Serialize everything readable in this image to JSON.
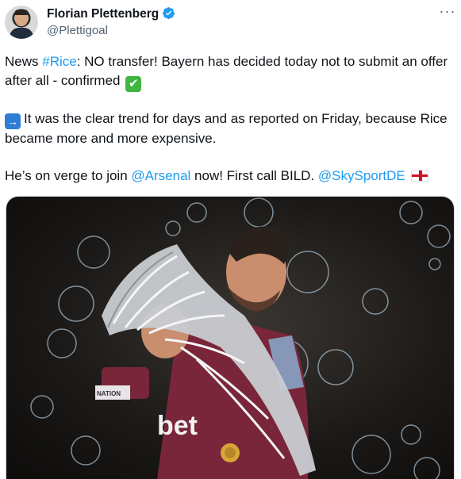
{
  "author": {
    "display_name": "Florian Plettenberg",
    "handle": "@Plettigoal",
    "verified": true,
    "avatar_icon": "profile-photo"
  },
  "menu": {
    "more_label": "···"
  },
  "tweet": {
    "line1_prefix": "News ",
    "hashtag": "#Rice",
    "line1_suffix": ": NO transfer! Bayern has decided today not to submit an offer after all - confirmed",
    "check_emoji": "✔",
    "arrow_emoji": "→",
    "paragraph2": "It was the clear trend for days and as reported on Friday, because Rice became more and more expensive.",
    "p3_prefix": "He’s on verge to join ",
    "mention_arsenal": "@Arsenal",
    "p3_middle": " now! First call BILD. ",
    "mention_sky": "@SkySportDE",
    "flag_emoji": "england-flag"
  },
  "media": {
    "kind": "photo",
    "jersey_text": "bet",
    "patch_text": "NATION",
    "colors": {
      "jersey": "#7a263a",
      "trophy": "#c9ccd1",
      "background": "#1c1a18",
      "link": "#1d9bf0",
      "verified": "#1d9bf0"
    }
  }
}
